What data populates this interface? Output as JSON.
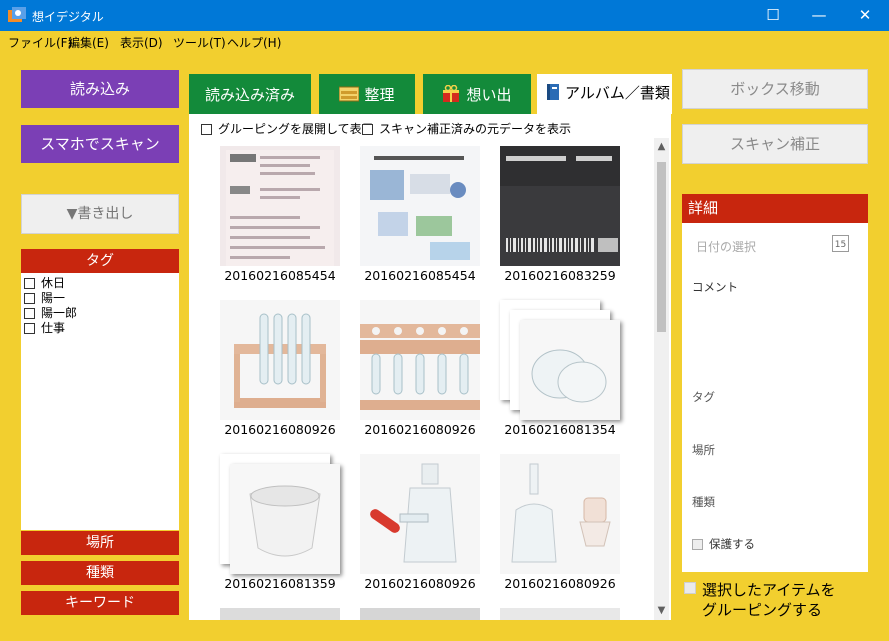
{
  "window": {
    "title": "想イデジタル",
    "min_glyph": "—",
    "max_glyph": "☐",
    "close_glyph": "✕"
  },
  "menu": [
    "ファイル(F)",
    "編集(E)",
    "表示(D)",
    "ツール(T)",
    "ヘルプ(H)"
  ],
  "left": {
    "import_label": "読み込み",
    "scan_label": "スマホでスキャン",
    "export_label": "▼書き出し",
    "tag_header": "タグ",
    "tags": [
      "休日",
      "陽一",
      "陽一郎",
      "仕事"
    ],
    "place_label": "場所",
    "type_label": "種類",
    "keyword_label": "キーワード"
  },
  "tabs": [
    "読み込み済み",
    "整理",
    "想い出",
    "アルバム／書類"
  ],
  "options": {
    "expand_grouping": "グルーピングを展開して表示",
    "scan_original": "スキャン補正済みの元データを表示"
  },
  "thumbnails": [
    {
      "label": "20160216085454",
      "icon": "document-flyer"
    },
    {
      "label": "20160216085454",
      "icon": "document-brochure"
    },
    {
      "label": "20160216083259",
      "icon": "barcode-label"
    },
    {
      "label": "20160216080926",
      "icon": "test-tube-rack"
    },
    {
      "label": "20160216080926",
      "icon": "test-tube-rack"
    },
    {
      "label": "20160216081354",
      "icon": "petri-dish-stack"
    },
    {
      "label": "20160216081359",
      "icon": "mortar-stack"
    },
    {
      "label": "20160216080926",
      "icon": "bottle-dropper"
    },
    {
      "label": "20160216080926",
      "icon": "spray-bottle"
    }
  ],
  "right": {
    "box_move_label": "ボックス移動",
    "scan_fix_label": "スキャン補正",
    "detail_header": "詳細",
    "date_placeholder": "日付の選択",
    "calendar_day": "15",
    "comment_label": "コメント",
    "tag_label": "タグ",
    "place_label": "場所",
    "type_label": "種類",
    "protect_label": "保護する",
    "group_selected_line1": "選択したアイテムを",
    "group_selected_line2": "グルーピングする"
  },
  "colors": {
    "background": "#f2cf2f",
    "titlebar": "#0078d7",
    "purple": "#7b3fb5",
    "red": "#c8260e",
    "green": "#138a3a"
  }
}
